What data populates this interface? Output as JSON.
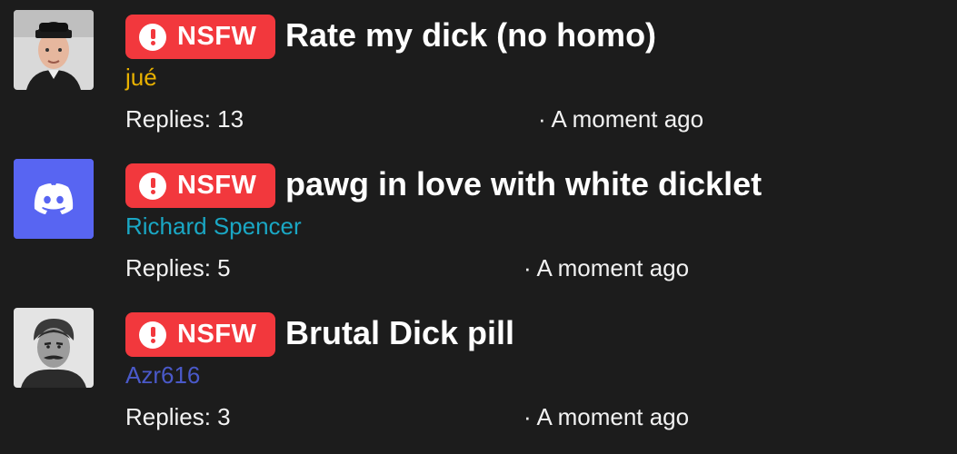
{
  "threads": [
    {
      "badge": "NSFW",
      "title": "Rate my dick (no homo)",
      "author": "jué",
      "author_color": "#e8b100",
      "replies": "Replies: 13",
      "time": "· A moment ago",
      "avatar": "portrait-photo-icon"
    },
    {
      "badge": "NSFW",
      "title": "pawg in love with white dicklet",
      "author": "Richard Spencer",
      "author_color": "#1aa7c4",
      "replies": "Replies: 5",
      "time": "· A moment ago",
      "avatar": "discord-icon"
    },
    {
      "badge": "NSFW",
      "title": "Brutal Dick pill",
      "author": "Azr616",
      "author_color": "#4a59c9",
      "replies": "Replies: 3",
      "time": "· A moment ago",
      "avatar": "portrait-photo-icon"
    }
  ],
  "colors": {
    "background": "#1c1c1c",
    "badge": "#f2383d",
    "discord": "#5865f2"
  }
}
